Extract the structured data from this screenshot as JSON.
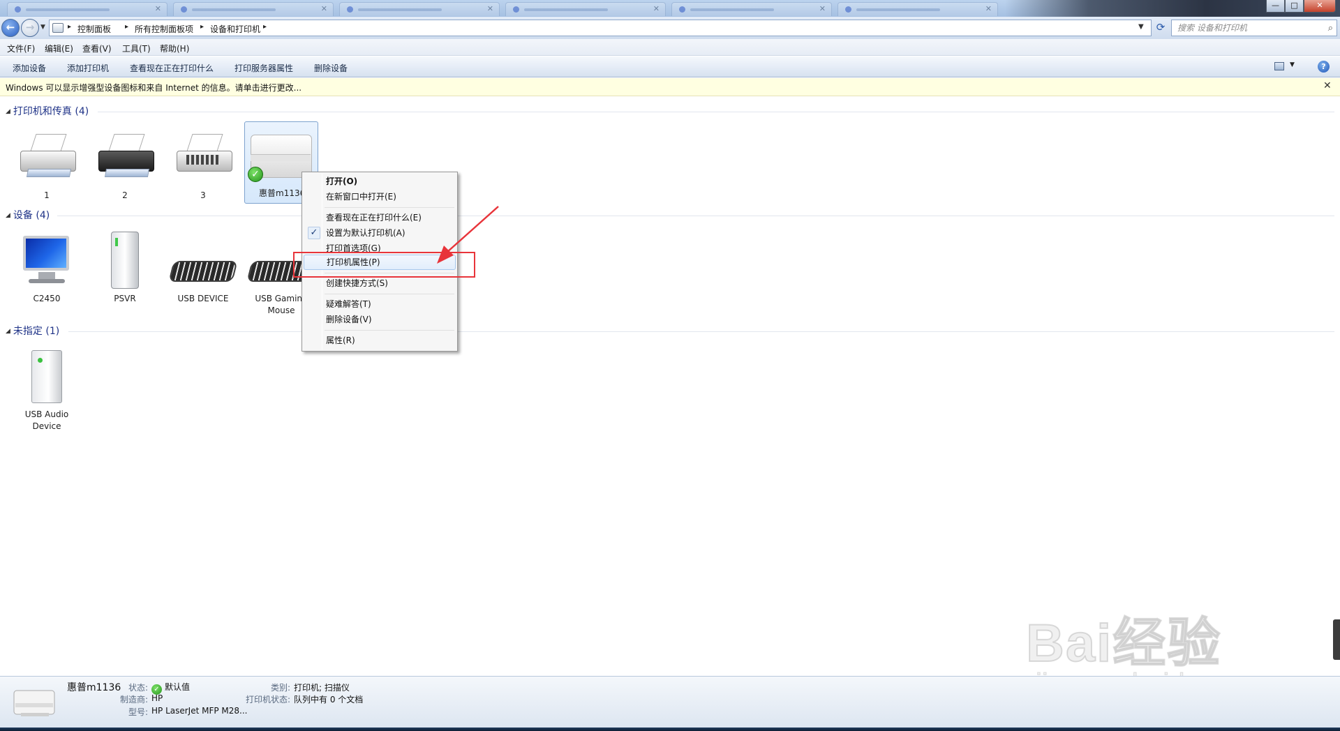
{
  "window": {
    "min_glyph": "—",
    "max_glyph": "□",
    "close_glyph": "✕"
  },
  "address": {
    "crumbs": [
      "控制面板",
      "所有控制面板项",
      "设备和打印机"
    ],
    "search_placeholder": "搜索 设备和打印机"
  },
  "menubar": {
    "items": [
      "文件(F)",
      "编辑(E)",
      "查看(V)",
      "工具(T)",
      "帮助(H)"
    ]
  },
  "commandbar": {
    "items": [
      "添加设备",
      "添加打印机",
      "查看现在正在打印什么",
      "打印服务器属性",
      "删除设备"
    ]
  },
  "infobar": {
    "text": "Windows 可以显示增强型设备图标和来自 Internet 的信息。请单击进行更改...",
    "close": "✕"
  },
  "groups": {
    "printers": {
      "header": "打印机和传真 (4)",
      "items": [
        {
          "label": "1",
          "icon": "printer-icon"
        },
        {
          "label": "2",
          "icon": "printer-icon"
        },
        {
          "label": "3",
          "icon": "fax-icon"
        },
        {
          "label": "惠普m1136",
          "icon": "multifunction-printer-icon",
          "default": true,
          "selected": true
        }
      ]
    },
    "devices": {
      "header": "设备 (4)",
      "items": [
        {
          "label": "C2450",
          "icon": "monitor-icon"
        },
        {
          "label": "PSVR",
          "icon": "tower-device-icon"
        },
        {
          "label": "USB DEVICE",
          "icon": "keyboard-icon"
        },
        {
          "label": "USB Gaming Mouse",
          "icon": "keyboard-icon"
        }
      ]
    },
    "unspecified": {
      "header": "未指定 (1)",
      "items": [
        {
          "label": "USB Audio Device",
          "icon": "storage-device-icon"
        }
      ]
    }
  },
  "context_menu": {
    "items": [
      {
        "label": "打开(O)",
        "bold": true
      },
      {
        "label": "在新窗口中打开(E)"
      },
      {
        "label": "查看现在正在打印什么(E)"
      },
      {
        "label": "设置为默认打印机(A)",
        "checked": true
      },
      {
        "label": "打印首选项(G)"
      },
      {
        "label": "打印机属性(P)",
        "hover": true,
        "highlighted": true
      },
      {
        "label": "创建快捷方式(S)"
      },
      {
        "label": "疑难解答(T)"
      },
      {
        "label": "删除设备(V)"
      },
      {
        "label": "属性(R)"
      }
    ],
    "check_glyph": "✓"
  },
  "details": {
    "name": "惠普m1136",
    "status_label": "状态:",
    "status_value": "默认值",
    "manufacturer_label": "制造商:",
    "manufacturer_value": "HP",
    "model_label": "型号:",
    "model_value": "HP LaserJet MFP M28...",
    "category_label": "类别:",
    "category_value": "打印机; 扫描仪",
    "printer_status_label": "打印机状态:",
    "printer_status_value": "队列中有 0 个文档"
  },
  "watermark": {
    "brand": "Bai经验",
    "url": "jingyan.baidu.com"
  },
  "colors": {
    "annotation_red": "#e8343a",
    "group_header_blue": "#1e3287",
    "infobar_yellow": "#ffffe1"
  }
}
